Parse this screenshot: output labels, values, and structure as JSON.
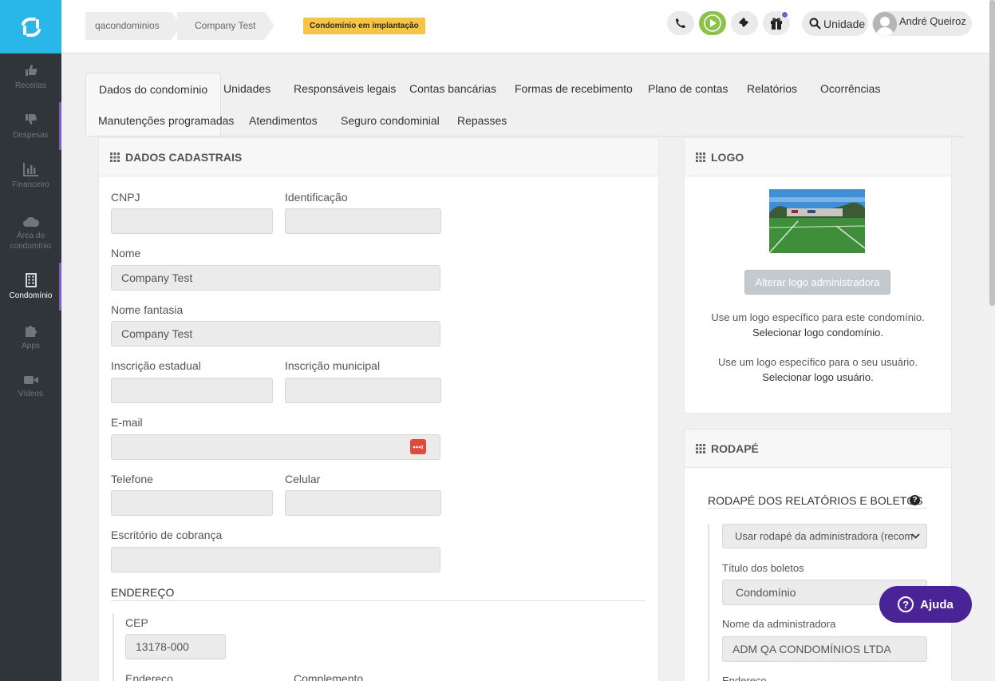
{
  "sidebar": {
    "items": [
      {
        "label": "Receitas",
        "icon": "thumbs-up-icon"
      },
      {
        "label": "Despesas",
        "icon": "thumbs-down-icon"
      },
      {
        "label": "Financeiro",
        "icon": "bar-chart-icon"
      },
      {
        "label": "Área do condomínio",
        "icon": "cloud-icon"
      },
      {
        "label": "Condomínio",
        "icon": "building-icon",
        "active": true
      },
      {
        "label": "Apps",
        "icon": "puzzle-icon"
      },
      {
        "label": "Vídeos",
        "icon": "video-camera-icon"
      }
    ]
  },
  "topbar": {
    "breadcrumbs": [
      "qacondominios",
      "Company Test"
    ],
    "badge": "Condomínio em implantação",
    "search_label": "Unidade",
    "user_name": "André Queiroz"
  },
  "tabs": [
    "Dados do condomínio",
    "Unidades",
    "Responsáveis legais",
    "Contas bancárias",
    "Formas de recebimento",
    "Plano de contas",
    "Relatórios",
    "Ocorrências",
    "Manutenções programadas",
    "Atendimentos",
    "Seguro condominial",
    "Repasses"
  ],
  "dados": {
    "title": "DADOS CADASTRAIS",
    "cnpj_label": "CNPJ",
    "cnpj_value": "",
    "identificacao_label": "Identificação",
    "identificacao_value": "",
    "nome_label": "Nome",
    "nome_value": "Company Test",
    "nome_fantasia_label": "Nome fantasia",
    "nome_fantasia_value": "Company Test",
    "inscricao_estadual_label": "Inscrição estadual",
    "inscricao_estadual_value": "",
    "inscricao_municipal_label": "Inscrição municipal",
    "inscricao_municipal_value": "",
    "email_label": "E-mail",
    "email_value": "",
    "telefone_label": "Telefone",
    "telefone_value": "",
    "celular_label": "Celular",
    "celular_value": "",
    "escritorio_label": "Escritório de cobrança",
    "escritorio_value": "",
    "endereco_title": "ENDEREÇO",
    "cep_label": "CEP",
    "cep_value": "13178-000",
    "endereco_label": "Endereço",
    "complemento_label": "Complemento"
  },
  "logo": {
    "title": "LOGO",
    "button": "Alterar logo administradora",
    "text1": "Use um logo específico para este condomínio.",
    "link1": "Selecionar logo condomínio.",
    "text2": "Use um logo específico para o seu usuário.",
    "link2": "Selecionar logo usuário."
  },
  "rodape": {
    "title": "RODAPÉ",
    "subtitle": "RODAPÉ DOS RELATÓRIOS E BOLETOS",
    "select_value": "Usar rodapé da administradora (recom",
    "titulo_label": "Título dos boletos",
    "titulo_value": "Condomínio",
    "admin_label": "Nome da administradora",
    "admin_value": "ADM QA CONDOMÍNIOS LTDA",
    "endereco_label": "Endereço"
  },
  "help": {
    "label": "Ajuda"
  },
  "colors": {
    "brand": "#29b6e8",
    "sidebar": "#2f3538",
    "accent": "#7d5cc6",
    "play": "#8bc24a",
    "badge": "#f6c544",
    "help": "#4a2497"
  }
}
